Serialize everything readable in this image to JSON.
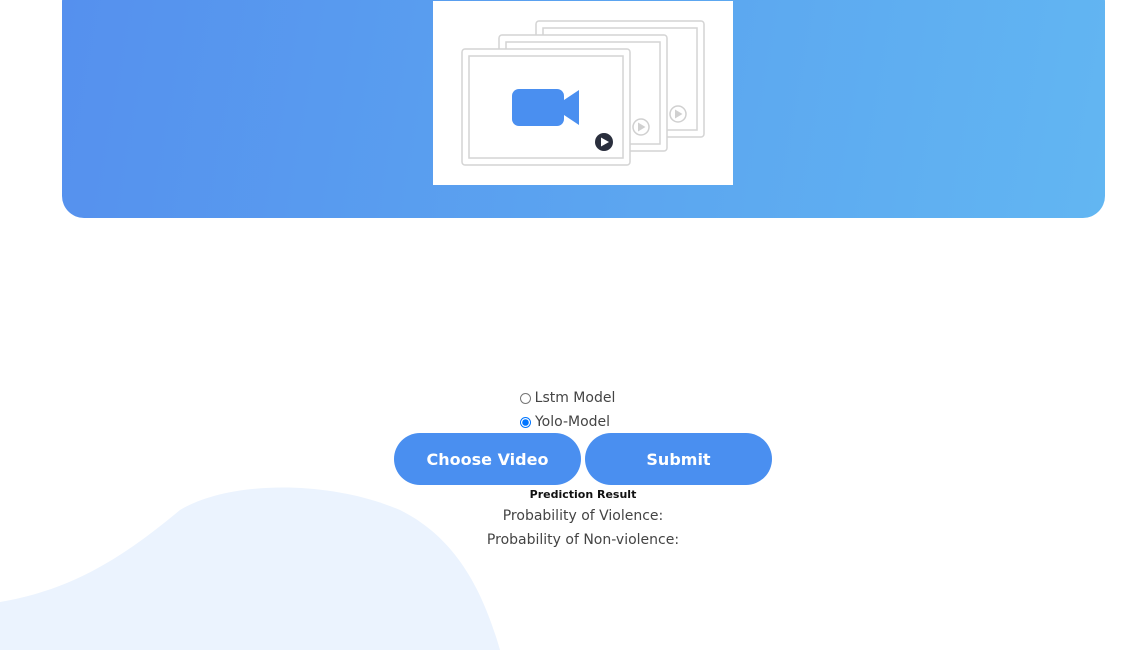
{
  "preview": {
    "icon": "video-camera-icon"
  },
  "model_selector": {
    "options": [
      {
        "label": "Lstm Model",
        "selected": false
      },
      {
        "label": "Yolo-Model",
        "selected": true
      }
    ]
  },
  "actions": {
    "choose_label": "Choose Video",
    "submit_label": "Submit"
  },
  "prediction": {
    "title": "Prediction Result",
    "violence_label": "Probability of Violence:",
    "nonviolence_label": "Probability of Non-violence:"
  },
  "colors": {
    "accent": "#4a8ff0",
    "hero_start": "#5590ee",
    "hero_end": "#62b6f2",
    "blob": "#ebf3fe"
  }
}
